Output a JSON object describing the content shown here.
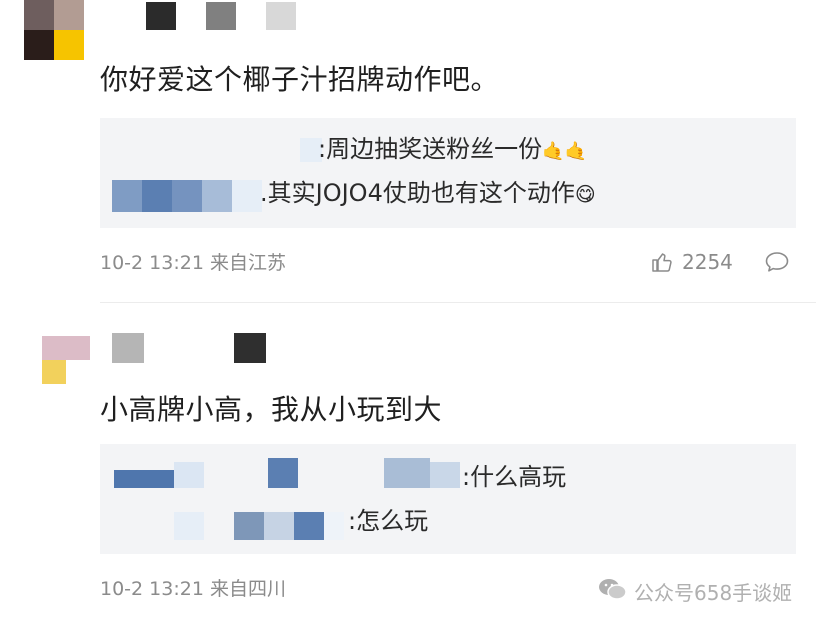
{
  "comments": [
    {
      "text": "你好爱这个椰子汁招牌动作吧。",
      "replies": [
        {
          "text": ":周边抽奖送粉丝一份",
          "emoji": "🤙🤙"
        },
        {
          "text": ".其实JOJO4仗助也有这个动作",
          "emoji": "😋"
        }
      ],
      "meta": "10-2 13:21 来自江苏",
      "likes": "2254"
    },
    {
      "text": "小高牌小高，我从小玩到大",
      "replies": [
        {
          "text": ":什么高玩"
        },
        {
          "text": ":怎么玩"
        }
      ],
      "meta": "10-2 13:21 来自四川"
    }
  ],
  "watermark": "公众号658手谈姬",
  "colors": {
    "reply_bg": "#f3f4f6",
    "meta": "#8b8b8b",
    "mosaic_blue": "#5b7fb2"
  }
}
